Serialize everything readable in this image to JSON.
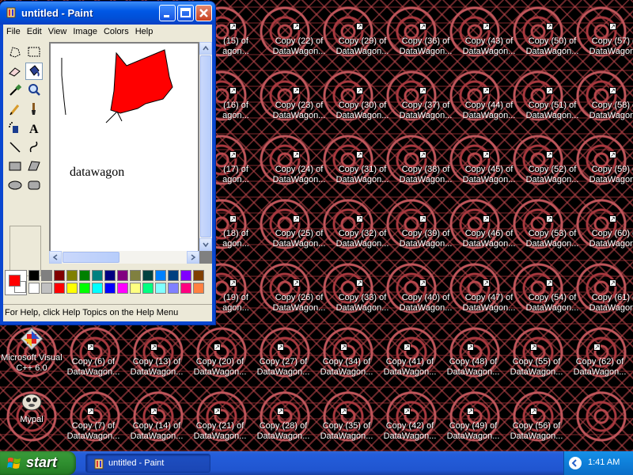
{
  "desktop": {
    "shortcut_rows": [
      [
        "(15) of\nagon...",
        "Copy (22) of\nDataWagon...",
        "Copy (29) of\nDataWagon...",
        "Copy (36) of\nDataWagon...",
        "Copy (43) of\nDataWagon...",
        "Copy (50) of\nDataWagon...",
        "Copy (57) of\nDataWagon..."
      ],
      [
        "(16) of\nagon...",
        "Copy (23) of\nDataWagon...",
        "Copy (30) of\nDataWagon...",
        "Copy (37) of\nDataWagon...",
        "Copy (44) of\nDataWagon...",
        "Copy (51) of\nDataWagon...",
        "Copy (58) of\nDataWagon..."
      ],
      [
        "(17) of\nagon...",
        "Copy (24) of\nDataWagon...",
        "Copy (31) of\nDataWagon...",
        "Copy (38) of\nDataWagon...",
        "Copy (45) of\nDataWagon...",
        "Copy (52) of\nDataWagon...",
        "Copy (59) of\nDataWagon..."
      ],
      [
        "(18) of\nagon...",
        "Copy (25) of\nDataWagon...",
        "Copy (32) of\nDataWagon...",
        "Copy (39) of\nDataWagon...",
        "Copy (46) of\nDataWagon...",
        "Copy (53) of\nDataWagon...",
        "Copy (60) of\nDataWagon..."
      ],
      [
        "(19) of\nagon...",
        "Copy (26) of\nDataWagon...",
        "Copy (33) of\nDataWagon...",
        "Copy (40) of\nDataWagon...",
        "Copy (47) of\nDataWagon...",
        "Copy (54) of\nDataWagon...",
        "Copy (61) of\nDataWagon..."
      ],
      [
        "Copy (6) of\nDataWagon...",
        "Copy (13) of\nDataWagon...",
        "Copy (20) of\nDataWagon...",
        "Copy (27) of\nDataWagon...",
        "Copy (34) of\nDataWagon...",
        "Copy (41) of\nDataWagon...",
        "Copy (48) of\nDataWagon...",
        "Copy (55) of\nDataWagon...",
        "Copy (62) of\nDataWagon..."
      ],
      [
        "Copy (7) of\nDataWagon...",
        "Copy (14) of\nDataWagon...",
        "Copy (21) of\nDataWagon...",
        "Copy (28) of\nDataWagon...",
        "Copy (35) of\nDataWagon...",
        "Copy (42) of\nDataWagon...",
        "Copy (49) of\nDataWagon...",
        "Copy (56) of\nDataWagon..."
      ]
    ],
    "app_icons": [
      {
        "label": "Microsoft Visual\nC++ 6.0",
        "icon": "visual-cpp-icon"
      },
      {
        "label": "Mypal",
        "icon": "mypal-icon"
      }
    ]
  },
  "paint": {
    "title": "untitled - Paint",
    "menu": [
      "File",
      "Edit",
      "View",
      "Image",
      "Colors",
      "Help"
    ],
    "canvas_text": "datawagon",
    "status": "For Help, click Help Topics on the Help Menu",
    "primary_color": "#ff0000",
    "secondary_color": "#ffffff",
    "palette_row1": [
      "#000000",
      "#808080",
      "#800000",
      "#808000",
      "#008000",
      "#008080",
      "#000080",
      "#800080",
      "#808040",
      "#004040",
      "#0080ff",
      "#004080",
      "#8000ff",
      "#804000"
    ],
    "palette_row2": [
      "#ffffff",
      "#c0c0c0",
      "#ff0000",
      "#ffff00",
      "#00ff00",
      "#00ffff",
      "#0000ff",
      "#ff00ff",
      "#ffff80",
      "#00ff80",
      "#80ffff",
      "#8080ff",
      "#ff0080",
      "#ff8040"
    ],
    "tools": [
      "free-select-icon",
      "rect-select-icon",
      "eraser-icon",
      "fill-icon",
      "color-picker-icon",
      "magnifier-icon",
      "pencil-icon",
      "brush-icon",
      "airbrush-icon",
      "text-icon",
      "line-icon",
      "curve-icon",
      "rectangle-icon",
      "polygon-icon",
      "ellipse-icon",
      "rounded-rect-icon"
    ]
  },
  "taskbar": {
    "start_label": "start",
    "task_label": "untitled - Paint",
    "clock": "1:41 AM"
  }
}
